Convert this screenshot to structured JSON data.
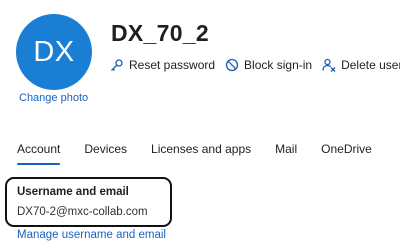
{
  "colors": {
    "avatar_bg": "#1a7fd4",
    "link": "#1565c0",
    "icon": "#1a5fb4",
    "tab_underline": "#1565c0"
  },
  "user": {
    "initials": "DX",
    "display_name": "DX_70_2",
    "change_photo_label": "Change photo"
  },
  "actions": [
    {
      "icon": "key-icon",
      "label": "Reset password"
    },
    {
      "icon": "block-icon",
      "label": "Block sign-in"
    },
    {
      "icon": "delete-user-icon",
      "label": "Delete user"
    }
  ],
  "tabs": [
    {
      "label": "Account",
      "active": true
    },
    {
      "label": "Devices",
      "active": false
    },
    {
      "label": "Licenses and apps",
      "active": false
    },
    {
      "label": "Mail",
      "active": false
    },
    {
      "label": "OneDrive",
      "active": false
    }
  ],
  "account": {
    "section_title": "Username and email",
    "email": "DX70-2@mxc-collab.com",
    "manage_link": "Manage username and email"
  }
}
